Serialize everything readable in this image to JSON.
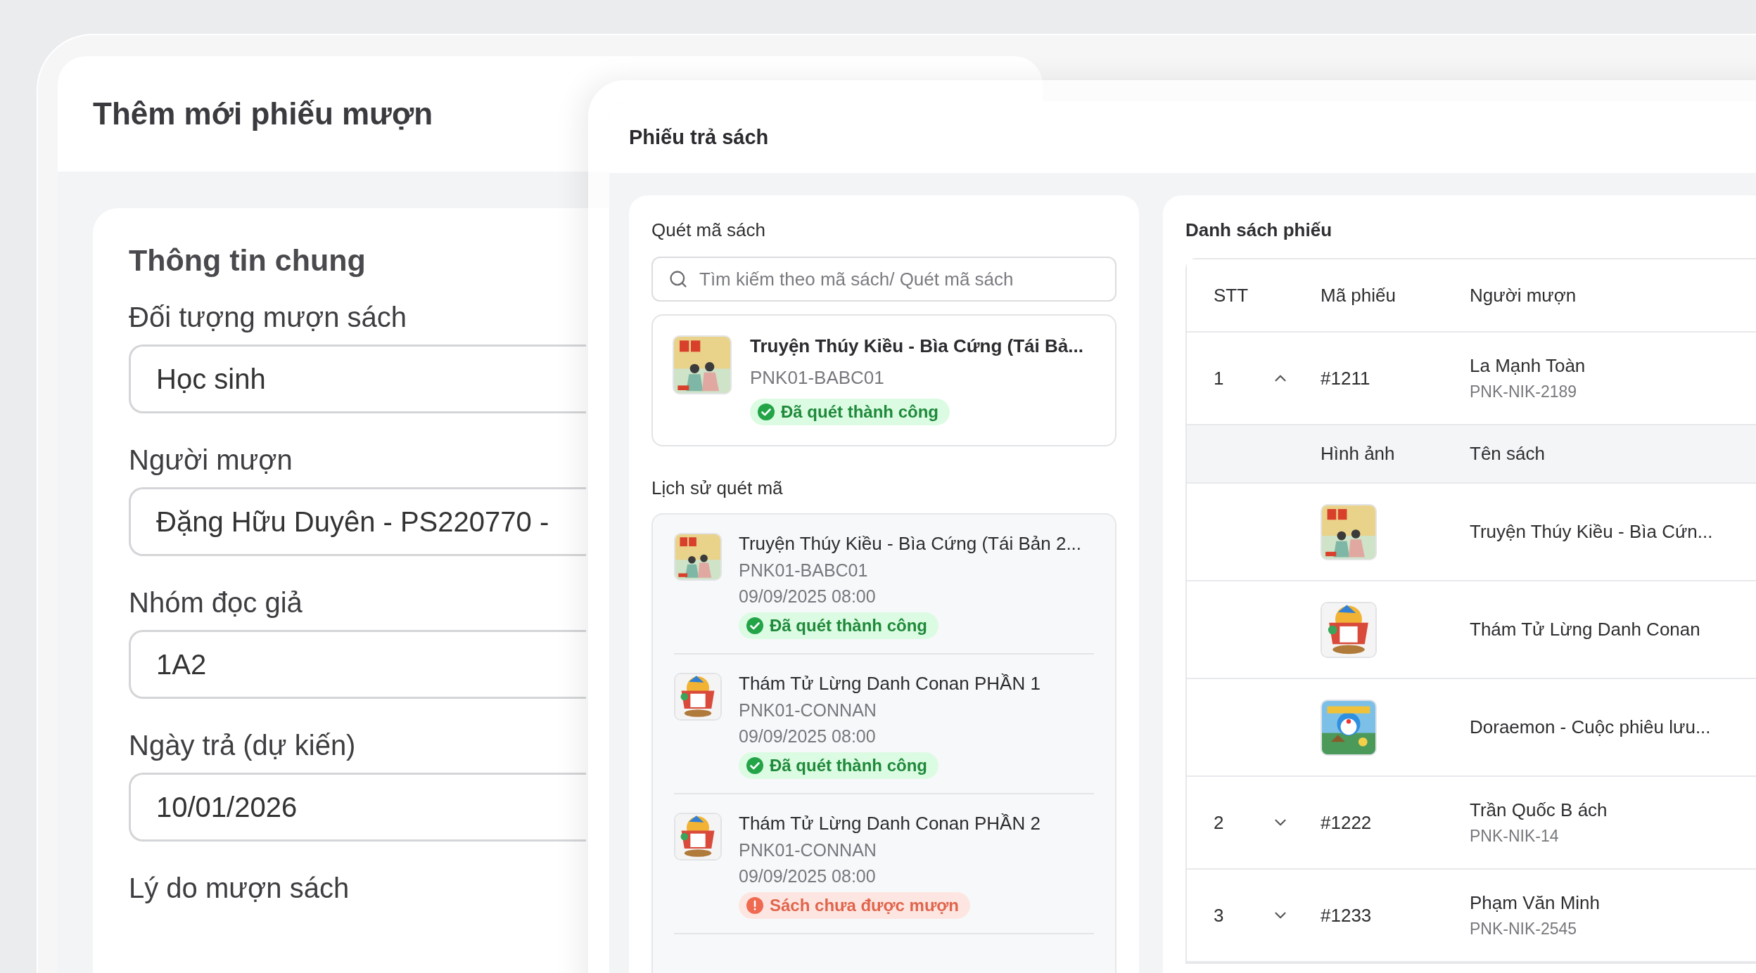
{
  "back_window": {
    "title": "Thêm mới phiếu mượn",
    "section_title": "Thông tin chung",
    "fields": [
      {
        "label": "Đối tượng mượn sách",
        "value": "Học sinh"
      },
      {
        "label": "Người mượn",
        "value": "Đặng Hữu Duyên - PS220770 -"
      },
      {
        "label": "Nhóm đọc giả",
        "value": "1A2"
      },
      {
        "label": "Ngày trả (dự kiến)",
        "value": "10/01/2026"
      },
      {
        "label": "Lý do mượn sách"
      }
    ]
  },
  "front_window": {
    "title": "Phiếu trả sách",
    "scan_panel": {
      "title": "Quét mã sách",
      "search": {
        "placeholder": "Tìm kiếm theo mã sách/ Quét mã sách"
      },
      "scanned": {
        "title": "Truyện Thúy Kiều - Bìa Cứng (Tái Bả...",
        "code": "PNK01-BABC01",
        "status": {
          "kind": "success",
          "label": "Đã quét thành công"
        }
      },
      "history_title": "Lịch sử quét mã",
      "history": [
        {
          "title": "Truyện Thúy Kiều - Bìa Cứng (Tái Bản 2...",
          "code": "PNK01-BABC01",
          "time": "09/09/2025 08:00",
          "status": {
            "kind": "success",
            "label": "Đã quét thành công"
          }
        },
        {
          "title": "Thám Tử Lừng Danh Conan PHẦN 1",
          "code": "PNK01-CONNAN",
          "time": "09/09/2025 08:00",
          "status": {
            "kind": "success",
            "label": "Đã quét thành công"
          }
        },
        {
          "title": "Thám Tử Lừng Danh Conan PHẦN 2",
          "code": "PNK01-CONNAN",
          "time": "09/09/2025 08:00",
          "status": {
            "kind": "error",
            "label": "Sách chưa được mượn"
          }
        }
      ]
    },
    "list_panel": {
      "title": "Danh sách phiếu",
      "columns": [
        "STT",
        "Mã phiếu",
        "Người mượn"
      ],
      "rows": [
        {
          "stt": "1",
          "code": "#1211",
          "borrower": "La Mạnh Toàn",
          "borrower_code": "PNK-NIK-2189",
          "expanded": true,
          "book_columns": [
            "Hình ảnh",
            "Tên sách"
          ],
          "books": [
            {
              "title": "Truyện Thúy Kiều - Bìa Cứn..."
            },
            {
              "title": "Thám Tử Lừng Danh Conan"
            },
            {
              "title": "Doraemon - Cuộc phiêu lưu..."
            }
          ]
        },
        {
          "stt": "2",
          "code": "#1222",
          "borrower": "Trần Quốc B ách",
          "borrower_code": "PNK-NIK-14",
          "expanded": false
        },
        {
          "stt": "3",
          "code": "#1233",
          "borrower": "Phạm Văn Minh",
          "borrower_code": "PNK-NIK-2545",
          "expanded": false
        }
      ]
    }
  }
}
